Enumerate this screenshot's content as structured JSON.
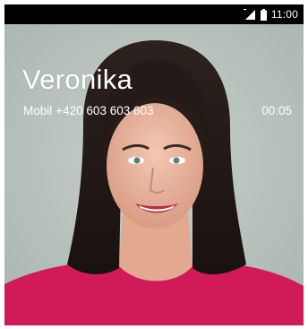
{
  "status_bar": {
    "time": "11:00",
    "signal_icon": "signal-icon",
    "battery_icon": "battery-icon",
    "background": "#000000"
  },
  "call": {
    "caller_name": "Veronika",
    "number_type": "Mobil",
    "phone_number": "+420 603 603 603",
    "duration": "00:05"
  },
  "colors": {
    "text": "#ffffff",
    "shirt": "#d01a5a",
    "hair": "#241a17"
  }
}
